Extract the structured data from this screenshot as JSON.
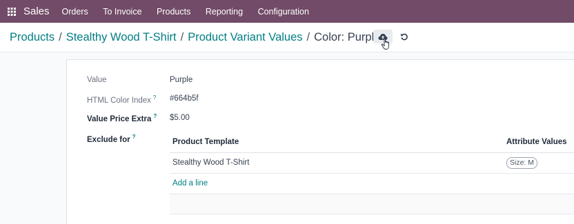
{
  "navbar": {
    "app_name": "Sales",
    "menu": [
      "Orders",
      "To Invoice",
      "Products",
      "Reporting",
      "Configuration"
    ],
    "color": "#714b67"
  },
  "breadcrumb": {
    "items": [
      "Products",
      "Stealthy Wood T-Shirt",
      "Product Variant Values"
    ],
    "separator": "/",
    "current": "Color: Purple",
    "link_color": "#017e84"
  },
  "form": {
    "value": {
      "label": "Value",
      "value": "Purple"
    },
    "html_color": {
      "label": "HTML Color Index",
      "help": "?",
      "value": "#664b5f"
    },
    "price_extra": {
      "label": "Value Price Extra",
      "help": "?",
      "value": "$5.00"
    },
    "exclude_for": {
      "label": "Exclude for",
      "help": "?"
    }
  },
  "exclusions_table": {
    "columns": [
      "Product Template",
      "Attribute Values"
    ],
    "rows": [
      {
        "template": "Stealthy Wood T-Shirt",
        "attribute_values": [
          "Size: M"
        ]
      }
    ],
    "add_line_label": "Add a line"
  },
  "icons": {
    "apps": "apps-grid-icon",
    "save": "cloud-upload-icon",
    "discard": "undo-icon",
    "cursor": "hand-pointer-icon"
  }
}
